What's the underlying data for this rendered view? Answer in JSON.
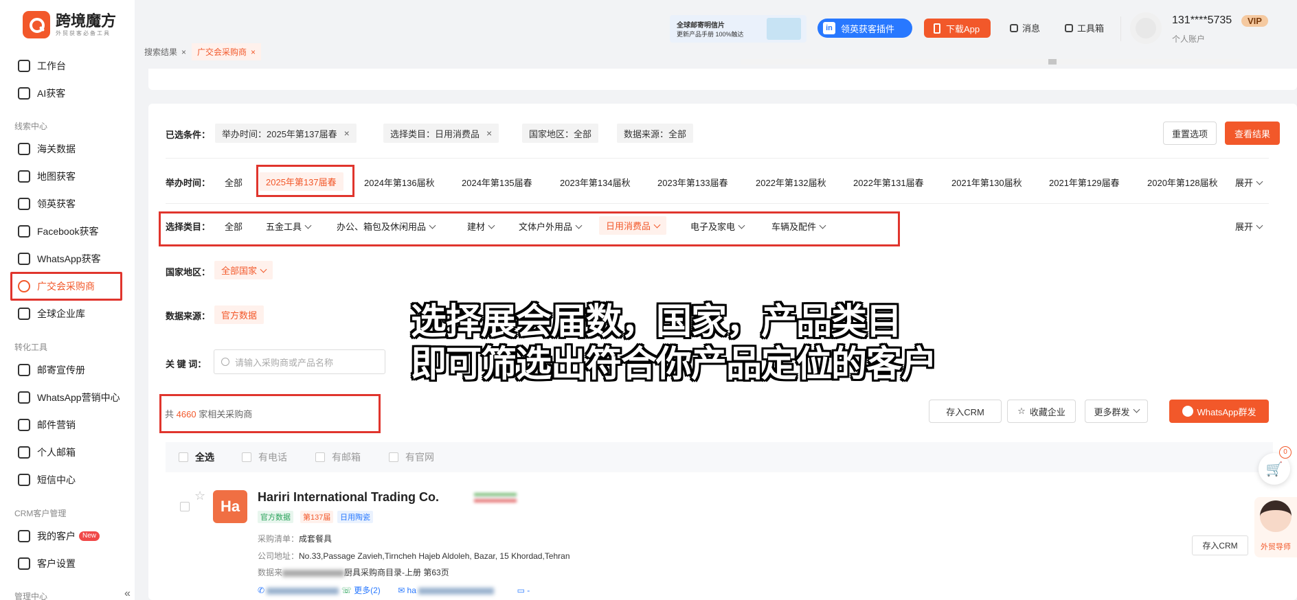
{
  "app": {
    "name": "跨境魔方",
    "slogan": "外贸获客必备工具"
  },
  "sidebar": {
    "items_top": [
      {
        "label": "工作台",
        "icon": "home-icon"
      },
      {
        "label": "AI获客",
        "icon": "ai-icon"
      }
    ],
    "section_leads": "线索中心",
    "items_leads": [
      {
        "label": "海关数据",
        "icon": "ship-icon"
      },
      {
        "label": "地图获客",
        "icon": "map-icon"
      },
      {
        "label": "领英获客",
        "icon": "linkedin-icon"
      },
      {
        "label": "Facebook获客",
        "icon": "facebook-icon"
      },
      {
        "label": "WhatsApp获客",
        "icon": "whatsapp-icon"
      },
      {
        "label": "广交会采购商",
        "icon": "globe-icon",
        "active": true
      },
      {
        "label": "全球企业库",
        "icon": "building-icon"
      }
    ],
    "section_tools": "转化工具",
    "items_tools": [
      {
        "label": "邮寄宣传册",
        "icon": "brochure-icon"
      },
      {
        "label": "WhatsApp营销中心",
        "icon": "whatsapp-icon"
      },
      {
        "label": "邮件营销",
        "icon": "mail-icon"
      },
      {
        "label": "个人邮箱",
        "icon": "inbox-icon"
      },
      {
        "label": "短信中心",
        "icon": "sms-icon"
      }
    ],
    "section_crm": "CRM客户管理",
    "items_crm": [
      {
        "label": "我的客户",
        "icon": "user-icon",
        "badge": "New"
      },
      {
        "label": "客户设置",
        "icon": "user-settings-icon"
      }
    ],
    "section_admin": "管理中心"
  },
  "tabs": [
    {
      "label": "搜索结果",
      "active": false
    },
    {
      "label": "广交会采购商",
      "active": true
    }
  ],
  "header": {
    "banner_title": "全球邮寄明信片",
    "banner_sub": "更新产品手册 100%触达",
    "plugin_label": "领英获客插件",
    "app_label": "下载App",
    "messages_label": "消息",
    "toolbox_label": "工具箱",
    "user_phone": "131****5735",
    "vip_label": "VIP",
    "account_label": "个人账户"
  },
  "selected": {
    "label": "已选条件：",
    "chips": [
      "举办时间：2025年第137届春",
      "选择类目：日用消费品",
      "国家地区：全部",
      "数据来源：全部"
    ],
    "reset_label": "重置选项",
    "view_label": "查看结果"
  },
  "time": {
    "label": "举办时间：",
    "options": [
      "全部",
      "2025年第137届春",
      "2024年第136届秋",
      "2024年第135届春",
      "2023年第134届秋",
      "2023年第133届春",
      "2022年第132届秋",
      "2022年第131届春",
      "2021年第130届秋",
      "2021年第129届春",
      "2020年第128届秋"
    ],
    "selected_index": 1,
    "expand_label": "展开"
  },
  "category": {
    "label": "选择类目：",
    "options": [
      "全部",
      "五金工具",
      "办公、箱包及休闲用品",
      "建材",
      "文体户外用品",
      "日用消费品",
      "电子及家电",
      "车辆及配件"
    ],
    "selected_index": 5,
    "expand_label": "展开"
  },
  "country": {
    "label": "国家地区：",
    "value": "全部国家"
  },
  "source": {
    "label": "数据来源：",
    "value": "官方数据"
  },
  "keyword": {
    "label": "关 键 词：",
    "placeholder": "请输入采购商或产品名称"
  },
  "results": {
    "prefix": "共",
    "count": "4660",
    "suffix": "家相关采购商",
    "save_crm_label": "存入CRM",
    "favorite_label": "收藏企业",
    "more_label": "更多群发",
    "whatsapp_label": "WhatsApp群发"
  },
  "filters": {
    "select_all": "全选",
    "has_phone": "有电话",
    "has_email": "有邮箱",
    "has_site": "有官网"
  },
  "overlay": {
    "line1": "选择展会届数，国家，产品类目",
    "line2": "即可筛选出符合你产品定位的客户"
  },
  "company": {
    "initials": "Ha",
    "name": "Hariri International Trading Co.",
    "tags": [
      "官方数据",
      "第137届",
      "日用陶瓷"
    ],
    "purchase_label": "采购清单：",
    "purchase_value": "成套餐具",
    "address_label": "公司地址：",
    "address_value": "No.33,Passage Zavieh,Tirncheh Hajeb Aldoleh, Bazar, 15 Khordad,Tehran",
    "data_label": "数据来",
    "data_value": "厨具采购商目录-上册 第63页",
    "more_phones": "更多(2)",
    "email_prefix": "ha",
    "site_value": "-",
    "save_crm_label": "存入CRM"
  },
  "floating": {
    "cart_count": "0",
    "assistant_label": "外贸导师"
  },
  "colors": {
    "accent": "#f2582a",
    "highlight_box": "#e0352d",
    "linkedin": "#2878ff"
  }
}
